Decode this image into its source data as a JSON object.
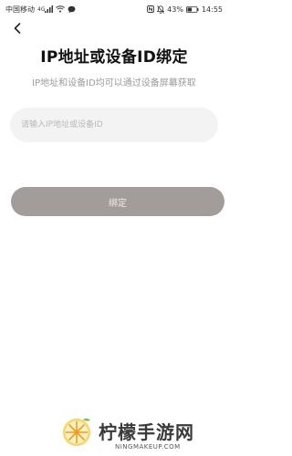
{
  "status_bar": {
    "carrier": "中国移动",
    "signal": "4G",
    "battery_percent": "43%",
    "time": "14:55"
  },
  "page": {
    "title": "IP地址或设备ID绑定",
    "subtitle": "IP地址和设备ID均可以通过设备屏幕获取"
  },
  "form": {
    "input_value": "",
    "input_placeholder": "请输入IP地址或设备ID",
    "bind_label": "绑定"
  },
  "watermark": {
    "brand_text": "柠檬手游网",
    "url": "NINGMAKEUP.COM"
  },
  "icons": {
    "back": "chevron-left-icon",
    "wifi": "wifi-icon",
    "message": "message-icon",
    "nfc": "nfc-icon",
    "mute": "bell-off-icon",
    "battery": "battery-icon"
  },
  "colors": {
    "button_bg": "#a29d9b",
    "input_bg": "#f3f3f3",
    "subtitle": "#9b9b9b",
    "watermark_orange": "#f39a1e",
    "watermark_green": "#7cc24a"
  }
}
